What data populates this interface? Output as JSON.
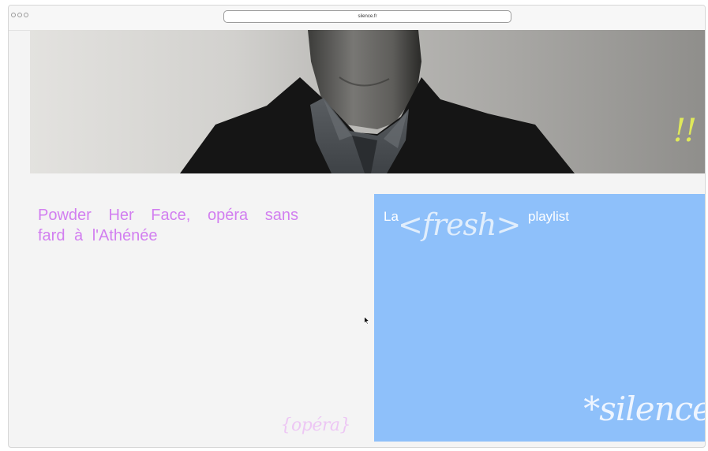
{
  "browser": {
    "url": "silence.fr",
    "traffic_lights": [
      "close-dot",
      "minimize-dot",
      "zoom-dot"
    ]
  },
  "hero": {
    "image": "portrait-photo",
    "accent_text": "!!",
    "accent_color": "#dfe85a"
  },
  "article_card": {
    "title": "Powder Her Face, opéra sans fard à l'Athénée",
    "category": "{opéra}",
    "title_color": "#d27ff0",
    "category_color": "#edc7f4"
  },
  "playlist_card": {
    "prefix": "La",
    "highlight": "<fresh>",
    "suffix": "playlist",
    "brand": "*silence",
    "background": "#8ec0fa"
  },
  "cursor": {
    "icon": "arrow-cursor-icon"
  }
}
